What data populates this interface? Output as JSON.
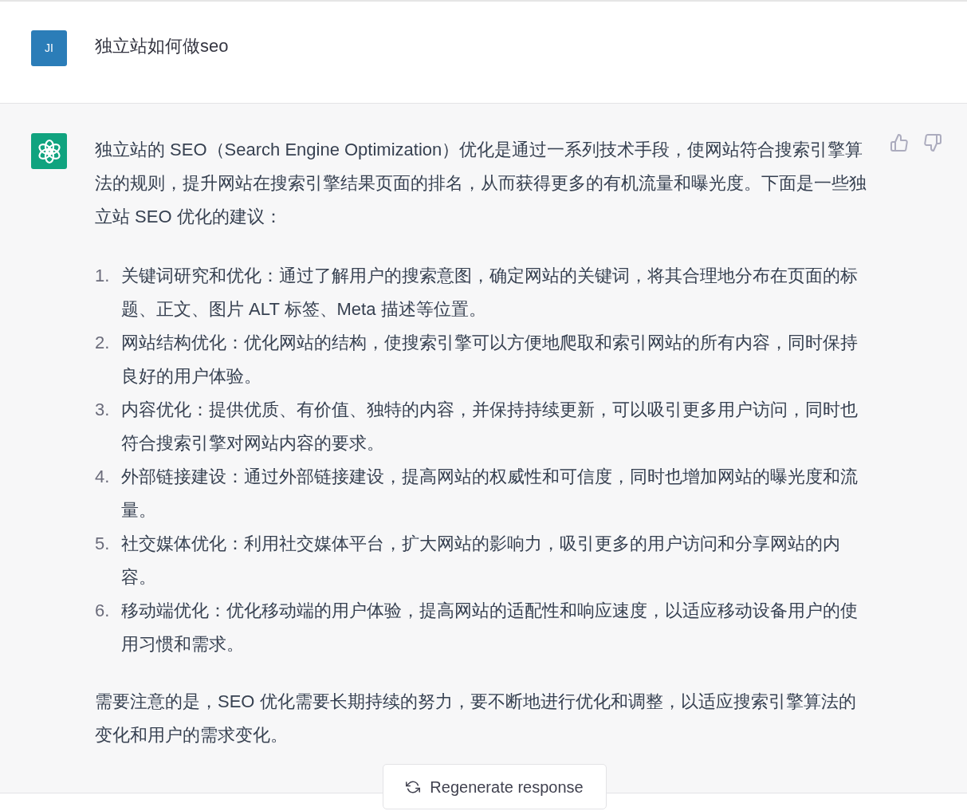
{
  "user_message": {
    "avatar_initials": "JI",
    "text": "独立站如何做seo"
  },
  "assistant_message": {
    "intro": "独立站的 SEO（Search Engine Optimization）优化是通过一系列技术手段，使网站符合搜索引擎算法的规则，提升网站在搜索引擎结果页面的排名，从而获得更多的有机流量和曝光度。下面是一些独立站 SEO 优化的建议：",
    "list": [
      {
        "number": "1.",
        "text": "关键词研究和优化：通过了解用户的搜索意图，确定网站的关键词，将其合理地分布在页面的标题、正文、图片 ALT 标签、Meta 描述等位置。"
      },
      {
        "number": "2.",
        "text": "网站结构优化：优化网站的结构，使搜索引擎可以方便地爬取和索引网站的所有内容，同时保持良好的用户体验。"
      },
      {
        "number": "3.",
        "text": "内容优化：提供优质、有价值、独特的内容，并保持持续更新，可以吸引更多用户访问，同时也符合搜索引擎对网站内容的要求。"
      },
      {
        "number": "4.",
        "text": "外部链接建设：通过外部链接建设，提高网站的权威性和可信度，同时也增加网站的曝光度和流量。"
      },
      {
        "number": "5.",
        "text": "社交媒体优化：利用社交媒体平台，扩大网站的影响力，吸引更多的用户访问和分享网站的内容。"
      },
      {
        "number": "6.",
        "text": "移动端优化：优化移动端的用户体验，提高网站的适配性和响应速度，以适应移动设备用户的使用习惯和需求。"
      }
    ],
    "conclusion": "需要注意的是，SEO 优化需要长期持续的努力，要不断地进行优化和调整，以适应搜索引擎算法的变化和用户的需求变化。"
  },
  "regenerate_button": {
    "label": "Regenerate response"
  }
}
